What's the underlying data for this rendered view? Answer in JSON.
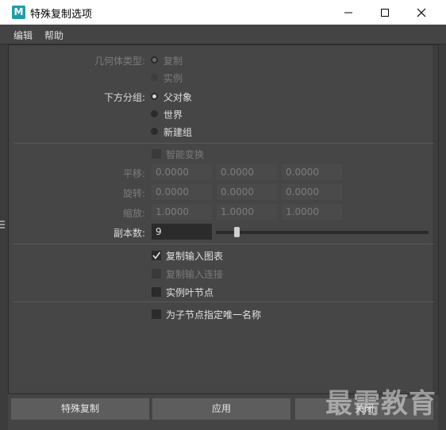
{
  "window": {
    "title": "特殊复制选项",
    "app_icon_letter": "M"
  },
  "menu": [
    "编辑",
    "帮助"
  ],
  "geometry_type": {
    "label": "几何体类型:",
    "options": [
      "复制",
      "实例"
    ],
    "selected": "复制",
    "enabled": false
  },
  "group_under": {
    "label": "下方分组:",
    "options": [
      "父对象",
      "世界",
      "新建组"
    ],
    "selected": "父对象"
  },
  "smart_transform": {
    "label": "智能变换",
    "checked": false,
    "enabled": false
  },
  "translate": {
    "label": "平移:",
    "values": [
      "0.0000",
      "0.0000",
      "0.0000"
    ]
  },
  "rotate": {
    "label": "旋转:",
    "values": [
      "0.0000",
      "0.0000",
      "0.0000"
    ]
  },
  "scale": {
    "label": "缩放:",
    "values": [
      "1.0000",
      "1.0000",
      "1.0000"
    ]
  },
  "copies": {
    "label": "副本数:",
    "value": "9",
    "slider_fraction": 0.03
  },
  "checkboxes": [
    {
      "label": "复制输入图表",
      "checked": true,
      "enabled": true
    },
    {
      "label": "复制输入连接",
      "checked": false,
      "enabled": false
    },
    {
      "label": "实例叶节点",
      "checked": false,
      "enabled": true
    },
    {
      "label": "为子节点指定唯一名称",
      "checked": false,
      "enabled": true
    }
  ],
  "buttons": {
    "duplicate": "特殊复制",
    "apply": "应用",
    "close": "关闭"
  },
  "watermark": "最需教育"
}
